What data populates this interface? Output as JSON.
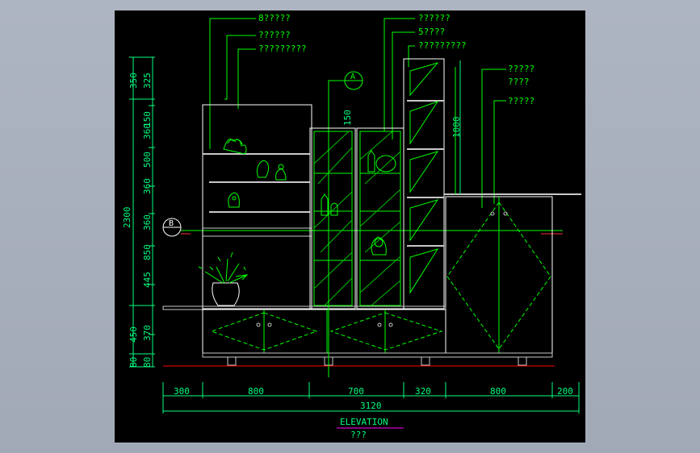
{
  "callouts_left": [
    "8?????",
    "??????",
    "?????????"
  ],
  "callouts_mid": [
    "??????",
    "5????",
    "?????????"
  ],
  "callouts_right": [
    "?????",
    "????",
    "?????"
  ],
  "section_markers": {
    "a": "A",
    "b": "B"
  },
  "vertical_dims_outer": {
    "total": "2300",
    "upper": "350",
    "lower_a": "450",
    "base": "80"
  },
  "vertical_dims_inner": [
    "325",
    "150",
    "360",
    "500",
    "360",
    "360",
    "850",
    "445",
    "370",
    "80"
  ],
  "local_dims": {
    "top_gap": "150",
    "column_height": "1000"
  },
  "horizontal_dims": [
    "300",
    "800",
    "700",
    "320",
    "800",
    "200"
  ],
  "horizontal_total": "3120",
  "title": "ELEVATION",
  "subtitle": "???",
  "colors": {
    "background": "#000000",
    "outline": "#00ff00",
    "dimension": "#00ff7f",
    "glass_hatch": "#00e000",
    "detail": "#c8c8c8",
    "floor_line": "#ff0000",
    "title_underline": "#ff00ff"
  }
}
